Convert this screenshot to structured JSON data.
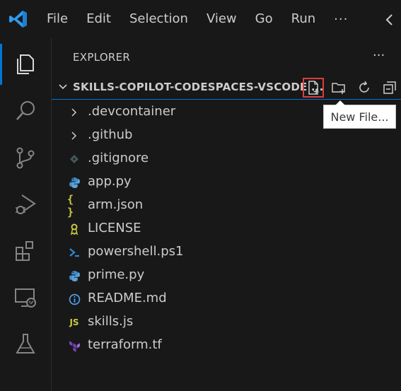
{
  "menu": [
    "File",
    "Edit",
    "Selection",
    "View",
    "Go",
    "Run"
  ],
  "menu_more": "···",
  "explorer": {
    "title": "EXPLORER",
    "more": "···",
    "section_title": "SKILLS-COPILOT-CODESPACES-VSCODE ...",
    "tooltip": "New File..."
  },
  "files": [
    {
      "name": ".devcontainer",
      "icon": "chevron-right-icon",
      "kind": "folder"
    },
    {
      "name": ".github",
      "icon": "chevron-right-icon",
      "kind": "folder"
    },
    {
      "name": ".gitignore",
      "icon": "git-icon",
      "kind": "file"
    },
    {
      "name": "app.py",
      "icon": "python-icon",
      "kind": "file"
    },
    {
      "name": "arm.json",
      "icon": "json-icon",
      "kind": "file"
    },
    {
      "name": "LICENSE",
      "icon": "license-icon",
      "kind": "file"
    },
    {
      "name": "powershell.ps1",
      "icon": "powershell-icon",
      "kind": "file"
    },
    {
      "name": "prime.py",
      "icon": "python-icon",
      "kind": "file"
    },
    {
      "name": "README.md",
      "icon": "info-icon",
      "kind": "file"
    },
    {
      "name": "skills.js",
      "icon": "javascript-icon",
      "kind": "file"
    },
    {
      "name": "terraform.tf",
      "icon": "terraform-icon",
      "kind": "file"
    }
  ],
  "icon_glyphs": {
    "json": "{ }",
    "js": "JS"
  },
  "colors": {
    "accent": "#0078d4",
    "highlight_box": "#e03c3c",
    "python": "#3b8ccc",
    "json": "#cbcb41",
    "license": "#cbcb41",
    "powershell": "#2d8ad6",
    "info": "#4d9fe2",
    "javascript": "#cbcb41",
    "terraform": "#7b42bc"
  }
}
